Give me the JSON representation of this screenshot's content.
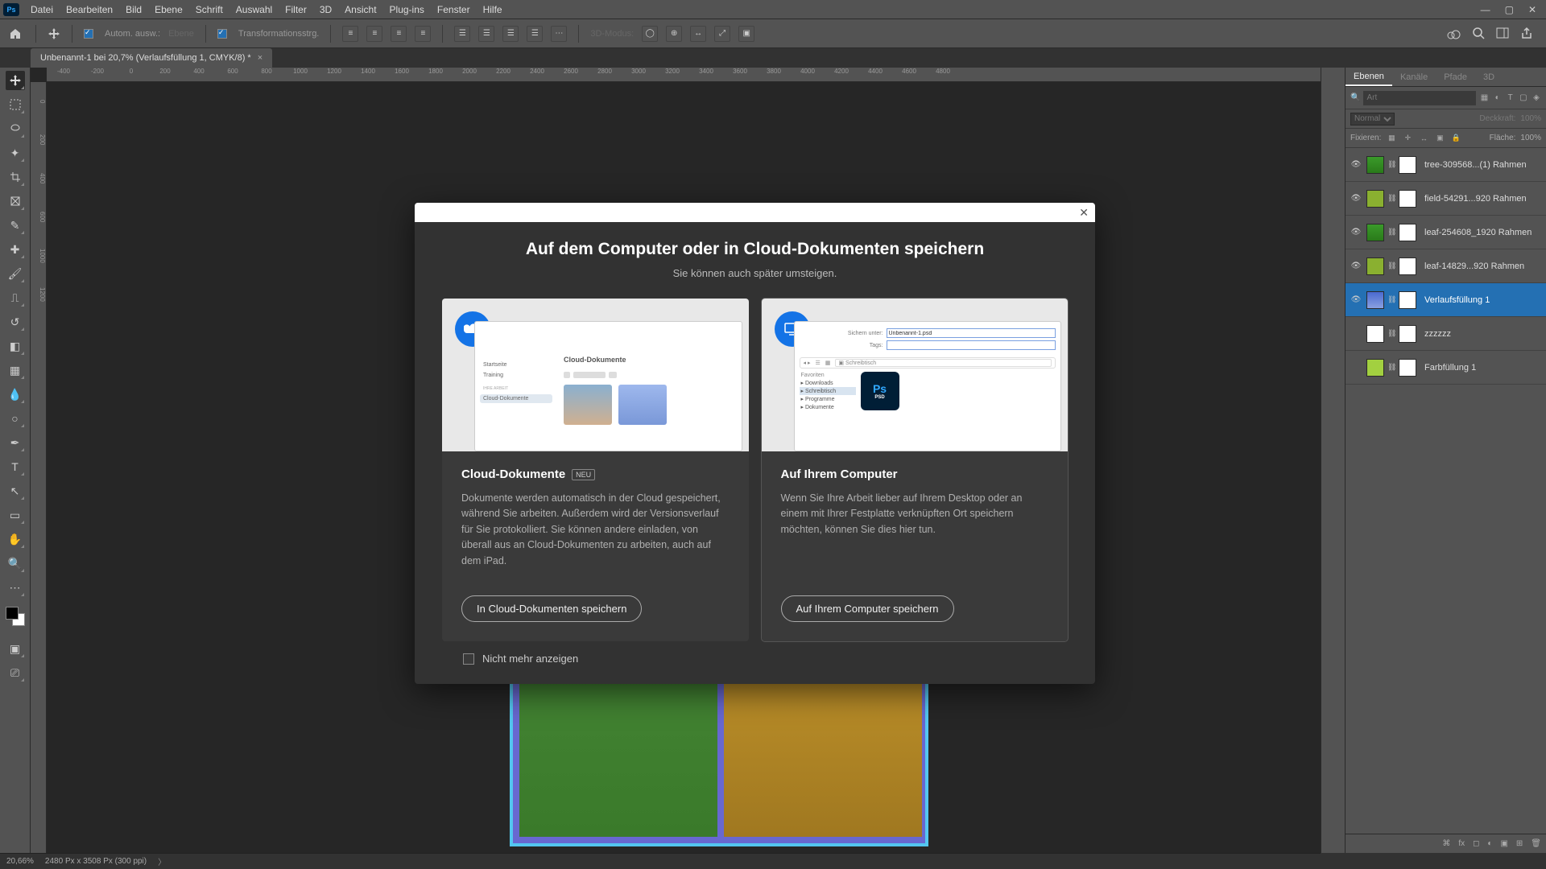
{
  "menubar": [
    "Datei",
    "Bearbeiten",
    "Bild",
    "Ebene",
    "Schrift",
    "Auswahl",
    "Filter",
    "3D",
    "Ansicht",
    "Plug-ins",
    "Fenster",
    "Hilfe"
  ],
  "optbar": {
    "auto": "Autom. ausw.:",
    "mode": "Ebene",
    "trans": "Transformationsstrg.",
    "d3": "3D-Modus:"
  },
  "doctab": {
    "title": "Unbenannt-1 bei 20,7% (Verlaufsfüllung 1, CMYK/8) *"
  },
  "rulerH": [
    "-400",
    "-200",
    "0",
    "200",
    "400",
    "600",
    "800",
    "1000",
    "1200",
    "1400",
    "1600",
    "1800",
    "2000",
    "2200",
    "2400",
    "2600",
    "2800",
    "3000",
    "3200",
    "3400",
    "3600",
    "3800",
    "4000",
    "4200",
    "4400",
    "4600",
    "4800"
  ],
  "rulerV": [
    "0",
    "200",
    "400",
    "600",
    "1000",
    "1200"
  ],
  "panels": {
    "tabs": [
      "Ebenen",
      "Kanäle",
      "Pfade",
      "3D"
    ],
    "searchPH": "Art",
    "blend": "Normal",
    "opacityL": "Deckkraft:",
    "opacityV": "100%",
    "lockL": "Fixieren:",
    "fillL": "Fläche:",
    "fillV": "100%"
  },
  "layers": [
    {
      "name": "tree-309568...(1) Rahmen",
      "eye": true,
      "thumb": "green"
    },
    {
      "name": "field-54291...920 Rahmen",
      "eye": true,
      "thumb": "lime"
    },
    {
      "name": "leaf-254608_1920 Rahmen",
      "eye": true,
      "thumb": "green"
    },
    {
      "name": "leaf-14829...920 Rahmen",
      "eye": true,
      "thumb": "lime"
    },
    {
      "name": "Verlaufsfüllung 1",
      "eye": true,
      "thumb": "grad",
      "sel": true
    },
    {
      "name": "zzzzzz",
      "eye": false,
      "thumb": "mask"
    },
    {
      "name": "Farbfüllung 1",
      "eye": false,
      "thumb": "fill"
    }
  ],
  "status": {
    "zoom": "20,66%",
    "dims": "2480 Px x 3508 Px (300 ppi)"
  },
  "modal": {
    "title": "Auf dem Computer oder in Cloud-Dokumenten speichern",
    "sub": "Sie können auch später umsteigen.",
    "cloud": {
      "h": "Cloud-Dokumente",
      "neu": "NEU",
      "p": "Dokumente werden automatisch in der Cloud gespeichert, während Sie arbeiten. Außerdem wird der Versionsverlauf für Sie protokolliert. Sie können andere einladen, von überall aus an Cloud-Dokumenten zu arbeiten, auch auf dem iPad.",
      "btn": "In Cloud-Dokumenten speichern",
      "side": [
        "Startseite",
        "Training",
        "IHRE ARBEIT",
        "Cloud-Dokumente"
      ],
      "hd": "Cloud-Dokumente"
    },
    "comp": {
      "h": "Auf Ihrem Computer",
      "p": "Wenn Sie Ihre Arbeit lieber auf Ihrem Desktop oder an einem mit Ihrer Festplatte verknüpften Ort speichern möchten, können Sie dies hier tun.",
      "btn": "Auf Ihrem Computer speichern",
      "saveL": "Sichern unter:",
      "saveV": "Unbenannt-1.psd",
      "tagsL": "Tags:",
      "loc": "Schreibtisch",
      "fav": "Favoriten",
      "folders": [
        "Downloads",
        "Schreibtisch",
        "Programme",
        "Dokumente"
      ]
    },
    "dont": "Nicht mehr anzeigen"
  }
}
